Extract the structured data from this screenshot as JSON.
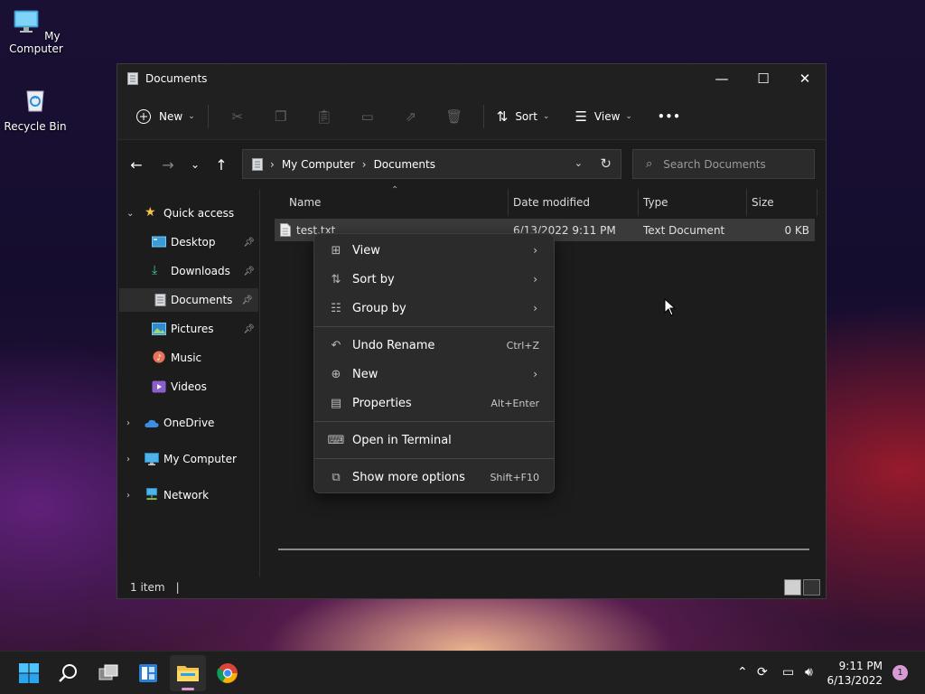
{
  "desktop": {
    "icons": [
      {
        "label": "My Computer",
        "icon": "computer-icon"
      },
      {
        "label": "Recycle Bin",
        "icon": "recycle-bin-icon"
      }
    ]
  },
  "window": {
    "title": "Documents",
    "controls": {
      "minimize": "—",
      "maximize": "☐",
      "close": "✕"
    }
  },
  "toolbar": {
    "new_label": "New",
    "sort_label": "Sort",
    "view_label": "View",
    "more_label": "•••",
    "disabled_icons": [
      "cut-icon",
      "copy-icon",
      "paste-icon",
      "rename-icon",
      "share-icon",
      "delete-icon"
    ]
  },
  "address": {
    "crumbs": [
      "My Computer",
      "Documents"
    ],
    "separator": "›"
  },
  "search": {
    "placeholder": "Search Documents"
  },
  "sidebar": {
    "items": [
      {
        "label": "Quick access",
        "icon": "star-icon",
        "expanded": true
      },
      {
        "label": "Desktop",
        "icon": "desktop-icon",
        "pinned": true
      },
      {
        "label": "Downloads",
        "icon": "downloads-icon",
        "pinned": true
      },
      {
        "label": "Documents",
        "icon": "documents-icon",
        "pinned": true,
        "active": true
      },
      {
        "label": "Pictures",
        "icon": "pictures-icon",
        "pinned": true
      },
      {
        "label": "Music",
        "icon": "music-icon"
      },
      {
        "label": "Videos",
        "icon": "videos-icon"
      },
      {
        "label": "OneDrive",
        "icon": "onedrive-icon"
      },
      {
        "label": "My Computer",
        "icon": "computer-icon"
      },
      {
        "label": "Network",
        "icon": "network-icon"
      }
    ]
  },
  "columns": {
    "name": "Name",
    "date": "Date modified",
    "type": "Type",
    "size": "Size"
  },
  "files": [
    {
      "name": "test.txt",
      "date": "6/13/2022 9:11 PM",
      "type": "Text Document",
      "size": "0 KB"
    }
  ],
  "status": {
    "count": "1 item"
  },
  "context_menu": {
    "items": [
      {
        "label": "View",
        "icon": "view-grid-icon",
        "submenu": true
      },
      {
        "label": "Sort by",
        "icon": "sort-icon",
        "submenu": true
      },
      {
        "label": "Group by",
        "icon": "group-icon",
        "submenu": true
      },
      {
        "label": "Undo Rename",
        "icon": "undo-icon",
        "shortcut": "Ctrl+Z"
      },
      {
        "label": "New",
        "icon": "new-icon",
        "submenu": true
      },
      {
        "label": "Properties",
        "icon": "properties-icon",
        "shortcut": "Alt+Enter"
      },
      {
        "label": "Open in Terminal",
        "icon": "terminal-icon"
      },
      {
        "label": "Show more options",
        "icon": "more-options-icon",
        "shortcut": "Shift+F10"
      }
    ]
  },
  "taskbar": {
    "apps": [
      "start-icon",
      "search-icon",
      "task-view-icon",
      "widgets-icon",
      "file-explorer-icon",
      "chrome-icon"
    ],
    "clock_time": "9:11 PM",
    "clock_date": "6/13/2022",
    "notifications": "1"
  },
  "colors": {
    "accent": "#d69bd5",
    "folder": "#f3c34b",
    "window_bg": "#1c1c1c"
  }
}
